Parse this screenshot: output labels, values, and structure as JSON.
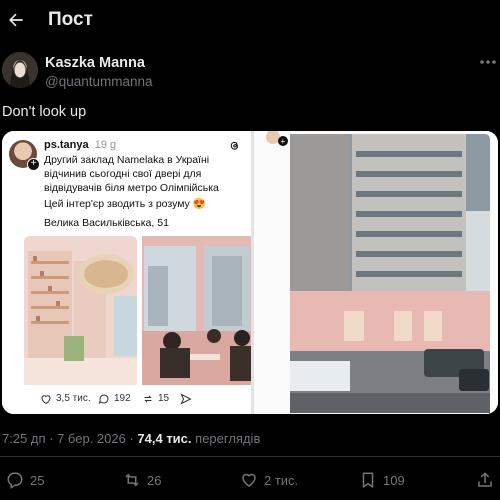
{
  "header": {
    "title": "Пост"
  },
  "author": {
    "name": "Kaszka Manna",
    "handle": "@quantummanna"
  },
  "post_text": "Don't look up",
  "embedded": {
    "user": "ps.tanya",
    "age": "19 g",
    "body": "Другий заклад Namelaka в Україні відчинив сьогодні свої двері для відвідувачів біля метро Олімпійська",
    "line2": "Цей інтер'єр зводить з розуму 😍",
    "address": "Велика Васильківська, 51",
    "likes": "3,5 тис.",
    "comments": "192",
    "reposts": "15"
  },
  "meta": {
    "time": "7:25 дп · 7 бер. 2026 ·",
    "views_count": "74,4 тис.",
    "views_label": "переглядів"
  },
  "actions": {
    "replies": "25",
    "reposts": "26",
    "likes": "2 тис.",
    "bookmarks": "109"
  },
  "colors": {
    "bg": "#000000",
    "text": "#e7e9ea",
    "muted": "#71767b",
    "border": "#2f3336"
  },
  "icons": [
    "back-arrow-icon",
    "more-icon",
    "reply-icon",
    "repost-icon",
    "like-icon",
    "bookmark-icon",
    "share-icon",
    "threads-logo-icon",
    "send-icon"
  ]
}
